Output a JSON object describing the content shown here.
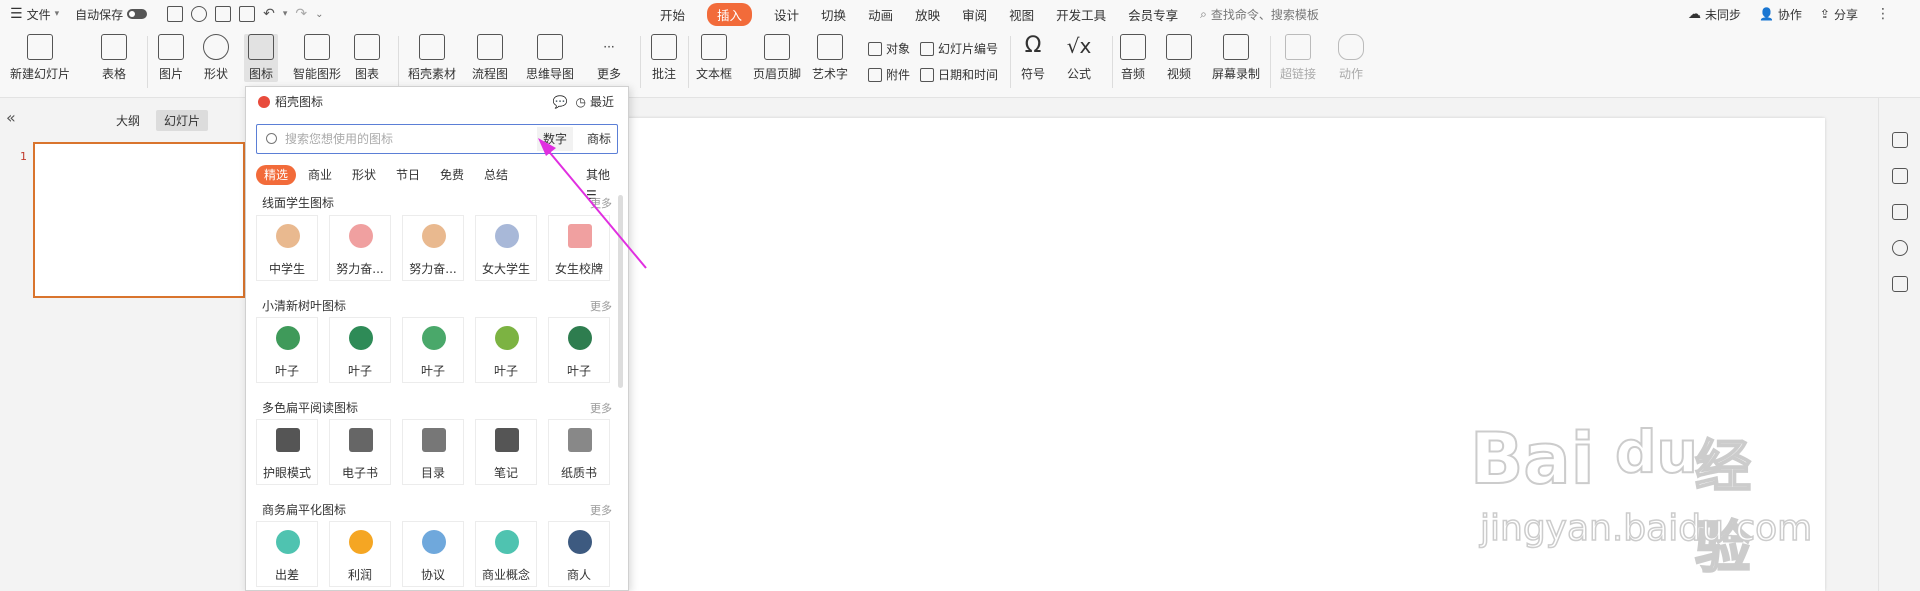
{
  "titlebar": {
    "file_label": "文件",
    "autosave_label": "自动保存",
    "tabs": [
      "开始",
      "插入",
      "设计",
      "切换",
      "动画",
      "放映",
      "审阅",
      "视图",
      "开发工具",
      "会员专享"
    ],
    "active_tab": "插入",
    "search_placeholder": "查找命令、搜索模板",
    "unsync_label": "未同步",
    "collab_label": "协作",
    "share_label": "分享"
  },
  "ribbon": {
    "new_slide": "新建幻灯片",
    "table": "表格",
    "image": "图片",
    "shape": "形状",
    "icon": "图标",
    "smartart": "智能图形",
    "chart": "图表",
    "material": "稻壳素材",
    "flowchart": "流程图",
    "mindmap": "思维导图",
    "more": "更多",
    "comment": "批注",
    "textbox": "文本框",
    "header_footer": "页眉页脚",
    "wordart": "艺术字",
    "object": "对象",
    "slide_number": "幻灯片编号",
    "attachment": "附件",
    "datetime": "日期和时间",
    "symbol": "符号",
    "formula": "公式",
    "audio": "音频",
    "video": "视频",
    "screen_record": "屏幕录制",
    "hyperlink": "超链接",
    "action": "动作"
  },
  "left_panel": {
    "tab_outline": "大纲",
    "tab_slides": "幻灯片",
    "slide_number": "1"
  },
  "popup": {
    "title": "稻壳图标",
    "recent": "最近",
    "search_placeholder": "搜索您想使用的图标",
    "btn_number": "数字",
    "btn_brand": "商标",
    "chips": [
      "精选",
      "商业",
      "形状",
      "节日",
      "免费",
      "总结"
    ],
    "other_label": "其他",
    "sections": [
      {
        "title": "线面学生图标",
        "more": "更多",
        "items": [
          "中学生",
          "努力奋...",
          "努力奋...",
          "女大学生",
          "女生校牌"
        ]
      },
      {
        "title": "小清新树叶图标",
        "more": "更多",
        "items": [
          "叶子",
          "叶子",
          "叶子",
          "叶子",
          "叶子"
        ]
      },
      {
        "title": "多色扁平阅读图标",
        "more": "更多",
        "items": [
          "护眼模式",
          "电子书",
          "目录",
          "笔记",
          "纸质书"
        ]
      },
      {
        "title": "商务扁平化图标",
        "more": "更多",
        "items": [
          "出差",
          "利润",
          "协议",
          "商业概念",
          "商人"
        ]
      }
    ]
  },
  "watermark": {
    "brand": "Bai",
    "brand2": "du",
    "cn": "经验",
    "url": "jingyan.baidu.com"
  },
  "colors": {
    "accent": "#f26b3a",
    "arrow": "#e02fe0",
    "slide_border": "#d9742d"
  }
}
